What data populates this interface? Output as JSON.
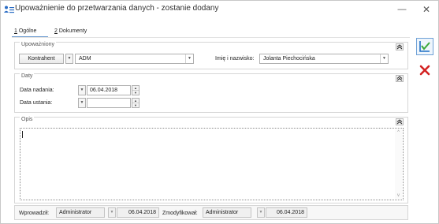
{
  "window": {
    "title": "Upoważnienie do przetwarzania danych - zostanie dodany",
    "minimize_glyph": "—",
    "close_glyph": "✕",
    "title_icon": "user-list-icon"
  },
  "tabs": [
    {
      "hotkey": "1",
      "label": " Ogólne",
      "active": true
    },
    {
      "hotkey": "2",
      "label": " Dokumenty",
      "active": false
    }
  ],
  "upowazniony": {
    "group_title": "Upoważniony",
    "type_button": "Kontrahent",
    "code_value": "ADM",
    "name_label": "Imię i nazwisko:",
    "name_value": "Jolanta Piechocińska"
  },
  "daty": {
    "group_title": "Daty",
    "nadania_label": "Data nadania:",
    "nadania_value": "06.04.2018",
    "ustania_label": "Data ustania:",
    "ustania_value": ""
  },
  "opis": {
    "group_title": "Opis",
    "value": ""
  },
  "footer": {
    "wprowadzil_label": "Wprowadził:",
    "wprowadzil_user": "Administrator",
    "wprowadzil_date": "06.04.2018",
    "zmodyfikowal_label": "Zmodyfikował:",
    "zmodyfikowal_user": "Administrator",
    "zmodyfikowal_date": "06.04.2018"
  },
  "side_toolbar": {
    "save_icon": "save-check-icon",
    "cancel_icon": "cancel-x-icon"
  },
  "colors": {
    "accent_blue": "#1f6fc5",
    "cancel_red": "#d32222",
    "check_green": "#3aa83a"
  }
}
